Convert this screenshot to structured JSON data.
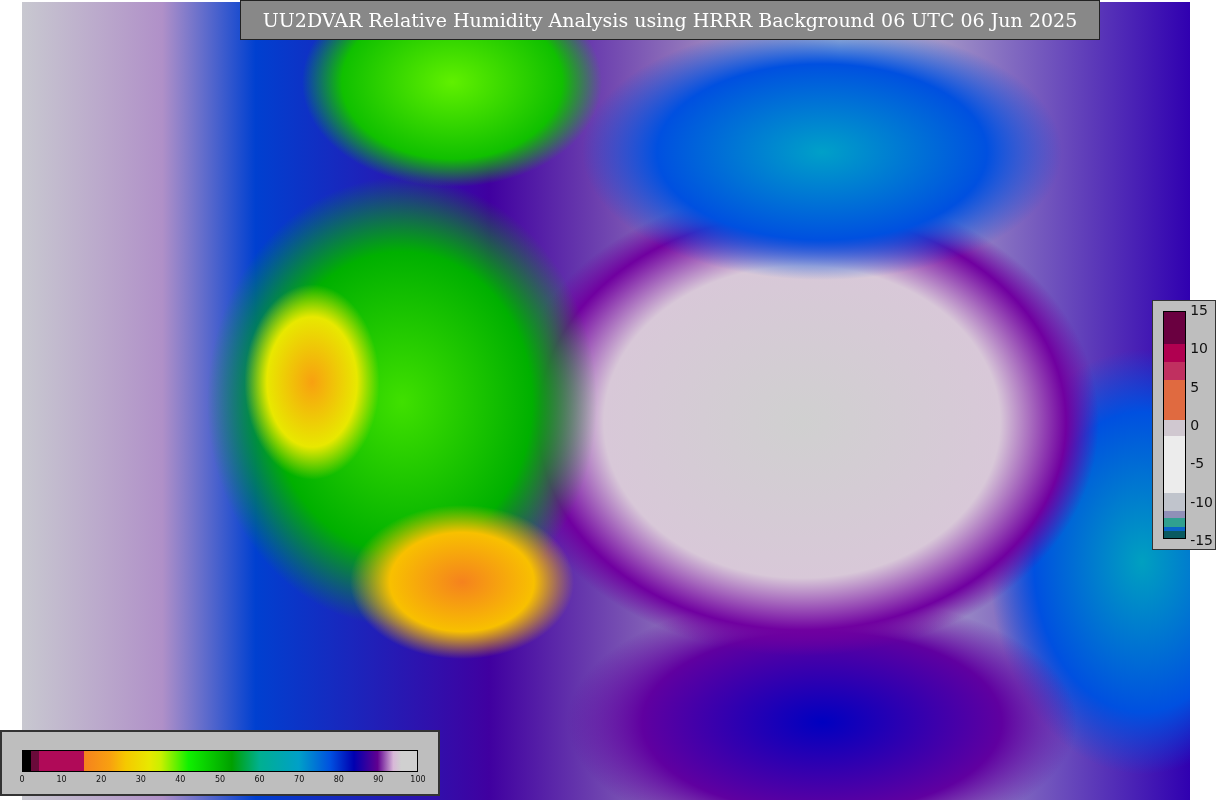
{
  "title": "UU2DVAR Relative Humidity Analysis using HRRR Background 06 UTC 06 Jun 2025",
  "colorbars": [
    {
      "kind": "horizontal",
      "ticks": [
        "0",
        "10",
        "20",
        "30",
        "40",
        "50",
        "60",
        "70",
        "80",
        "90",
        "100"
      ]
    },
    {
      "kind": "vertical",
      "ticks": [
        "15",
        "10",
        "5",
        "0",
        "-5",
        "-10",
        "-15"
      ]
    }
  ]
}
